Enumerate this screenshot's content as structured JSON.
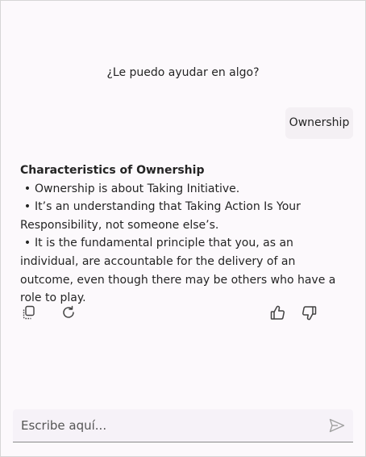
{
  "greeting": "¿Le puedo ayudar en algo?",
  "user_message": "Ownership",
  "response": {
    "title": "Characteristics of Ownership",
    "bullets": [
      "Ownership is about Taking Initiative.",
      "It’s an understanding that Taking Action Is Your Responsibility, not someone else’s.",
      "It is the fundamental principle that you, as an individual, are accountable for the delivery of an outcome, even though there may be others who have a role to play."
    ],
    "bullet_symbol": "•"
  },
  "actions": {
    "copy_icon": "copy-icon",
    "regenerate_icon": "refresh-icon",
    "like_icon": "thumbs-up-icon",
    "dislike_icon": "thumbs-down-icon"
  },
  "input": {
    "placeholder": "Escribe aquí...",
    "value": "",
    "send_icon": "send-icon"
  },
  "colors": {
    "background": "#fcf9fc",
    "bubble": "#f4f0f4",
    "input_bg": "#f6f2f8",
    "text": "#242424",
    "icon": "#424242",
    "send_icon": "#a0a0a0"
  }
}
